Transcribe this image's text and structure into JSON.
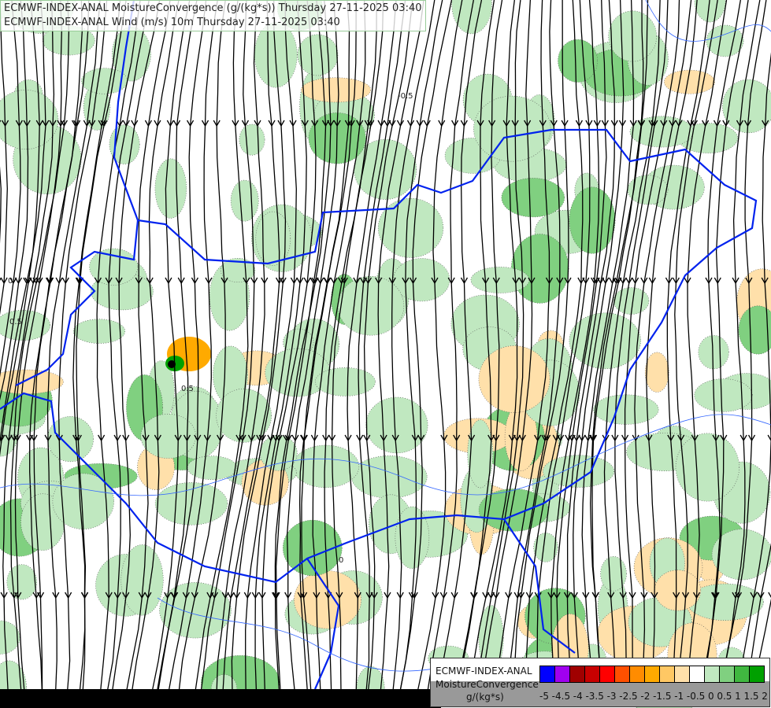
{
  "header": {
    "line1": "ECMWF-INDEX-ANAL MoistureConvergence (g/(kg*s)) Thursday 27-11-2025 03:40",
    "line2": "ECMWF-INDEX-ANAL Wind (m/s) 10m Thursday 27-11-2025 03:40"
  },
  "contour_labels": [
    "0",
    "0.5",
    "-0.5"
  ],
  "legend": {
    "title_line1": "ECMWF-INDEX-ANAL",
    "title_line2": "MoistureConvergence",
    "unit": "g/(kg*s)",
    "colors": [
      "#0000ff",
      "#a000f0",
      "#a00000",
      "#c80000",
      "#ff0000",
      "#ff5000",
      "#ff8c00",
      "#ffaa00",
      "#ffc864",
      "#ffe0aa",
      "#ffffff",
      "#c0e8c0",
      "#80d080",
      "#40b840",
      "#00a000"
    ],
    "tick_labels": [
      "-5",
      "-4.5",
      "-4",
      "-3.5",
      "-3",
      "-2.5",
      "-2",
      "-1.5",
      "-1",
      "-0.5",
      "0",
      "0.5",
      "1",
      "1.5",
      "2"
    ]
  },
  "colors": {
    "border": "#0022ee",
    "river": "#3366ff",
    "streamline": "#000000"
  }
}
